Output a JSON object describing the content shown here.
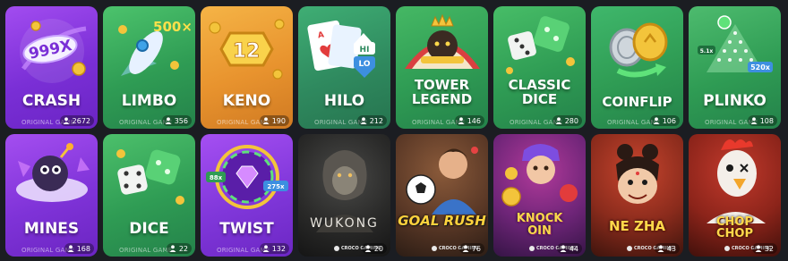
{
  "subtitle": "ORIGINAL GAME",
  "provider": "CROCO GAMING",
  "cards": [
    {
      "title": "CRASH",
      "players": "2672",
      "badge": "999X"
    },
    {
      "title": "LIMBO",
      "players": "356",
      "badge": "500×"
    },
    {
      "title": "KENO",
      "players": "190",
      "badge": "12"
    },
    {
      "title": "HILO",
      "players": "212",
      "badge_hi": "HI",
      "badge_lo": "LO"
    },
    {
      "title": "TOWER LEGEND",
      "players": "146"
    },
    {
      "title": "CLASSIC DICE",
      "players": "280"
    },
    {
      "title": "COINFLIP",
      "players": "106"
    },
    {
      "title": "PLINKO",
      "players": "108",
      "badge": "520x",
      "badge_small": "5.1x"
    },
    {
      "title": "MINES",
      "players": "168"
    },
    {
      "title": "DICE",
      "players": "22"
    },
    {
      "title": "TWIST",
      "players": "132",
      "badge_left": "88x",
      "badge_right": "275x"
    },
    {
      "title": "WUKONG",
      "players": "20"
    },
    {
      "title": "GOAL RUSH",
      "players": "76"
    },
    {
      "title": "KNOCK OIN",
      "players": "44"
    },
    {
      "title": "NE ZHA",
      "players": "43"
    },
    {
      "title": "CHOP CHOP",
      "players": "32"
    }
  ],
  "colors": {
    "purple": "#8b3fe0",
    "green": "#2f9c54",
    "orange": "#e8932e",
    "teal": "#2f8a5f"
  },
  "icons": [
    "user-icon"
  ]
}
